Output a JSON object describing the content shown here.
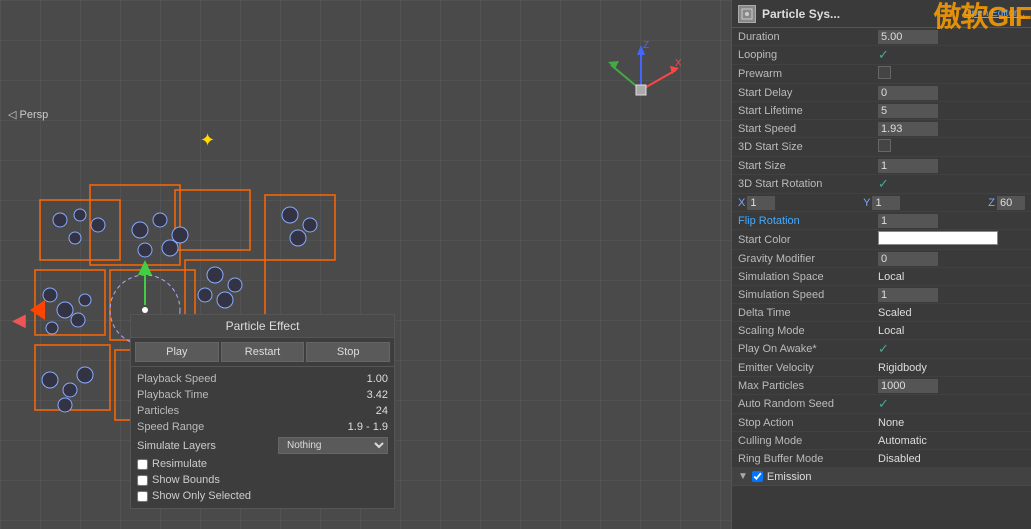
{
  "viewport": {
    "persp_label": "◁ Persp",
    "sun_symbol": "✦",
    "left_arrow": "◀"
  },
  "particle_panel": {
    "title": "Particle Effect",
    "buttons": {
      "play": "Play",
      "restart": "Restart",
      "stop": "Stop"
    },
    "rows": [
      {
        "label": "Playback Speed",
        "value": "1.00"
      },
      {
        "label": "Playback Time",
        "value": "3.42"
      },
      {
        "label": "Particles",
        "value": "24"
      },
      {
        "label": "Speed Range",
        "value": "1.9 - 1.9"
      }
    ],
    "simulate_layers_label": "Simulate Layers",
    "simulate_layers_value": "Nothing",
    "checkboxes": [
      {
        "label": "Resimulate",
        "checked": false
      },
      {
        "label": "Show Bounds",
        "checked": false
      },
      {
        "label": "Show Only Selected",
        "checked": false
      }
    ]
  },
  "right_panel": {
    "title": "Particle Sys...",
    "open_editor": "Open Editor...",
    "watermark": "傲软GIF",
    "properties": [
      {
        "label": "Duration",
        "value": "5.00",
        "type": "input"
      },
      {
        "label": "Looping",
        "value": "✓",
        "type": "check_on"
      },
      {
        "label": "Prewarm",
        "value": "",
        "type": "check_off"
      },
      {
        "label": "Start Delay",
        "value": "0",
        "type": "input"
      },
      {
        "label": "Start Lifetime",
        "value": "5",
        "type": "input"
      },
      {
        "label": "Start Speed",
        "value": "1.93",
        "type": "input"
      },
      {
        "label": "3D Start Size",
        "value": "",
        "type": "check_off"
      },
      {
        "label": "Start Size",
        "value": "1",
        "type": "input"
      },
      {
        "label": "3D Start Rotation",
        "value": "✓",
        "type": "check_on"
      }
    ],
    "xyz_row": {
      "x_label": "X",
      "x_value": "1",
      "y_label": "Y",
      "y_value": "1",
      "z_label": "Z",
      "z_value": "60"
    },
    "flip_rotation": {
      "label": "Flip Rotation",
      "value": "1"
    },
    "properties2": [
      {
        "label": "Start Color",
        "value": "",
        "type": "color"
      },
      {
        "label": "Gravity Modifier",
        "value": "0",
        "type": "input"
      },
      {
        "label": "Simulation Space",
        "value": "Local",
        "type": "text"
      },
      {
        "label": "Simulation Speed",
        "value": "1",
        "type": "input"
      },
      {
        "label": "Delta Time",
        "value": "Scaled",
        "type": "text"
      },
      {
        "label": "Scaling Mode",
        "value": "Local",
        "type": "text"
      },
      {
        "label": "Play On Awake*",
        "value": "✓",
        "type": "check_on"
      },
      {
        "label": "Emitter Velocity",
        "value": "Rigidbody",
        "type": "text"
      },
      {
        "label": "Max Particles",
        "value": "1000",
        "type": "input"
      },
      {
        "label": "Auto Random Seed",
        "value": "✓",
        "type": "check_on"
      },
      {
        "label": "Stop Action",
        "value": "None",
        "type": "text"
      },
      {
        "label": "Culling Mode",
        "value": "Automatic",
        "type": "text"
      },
      {
        "label": "Ring Buffer Mode",
        "value": "Disabled",
        "type": "text"
      }
    ],
    "emission": {
      "label": "Emission",
      "toggle": "▼"
    }
  }
}
